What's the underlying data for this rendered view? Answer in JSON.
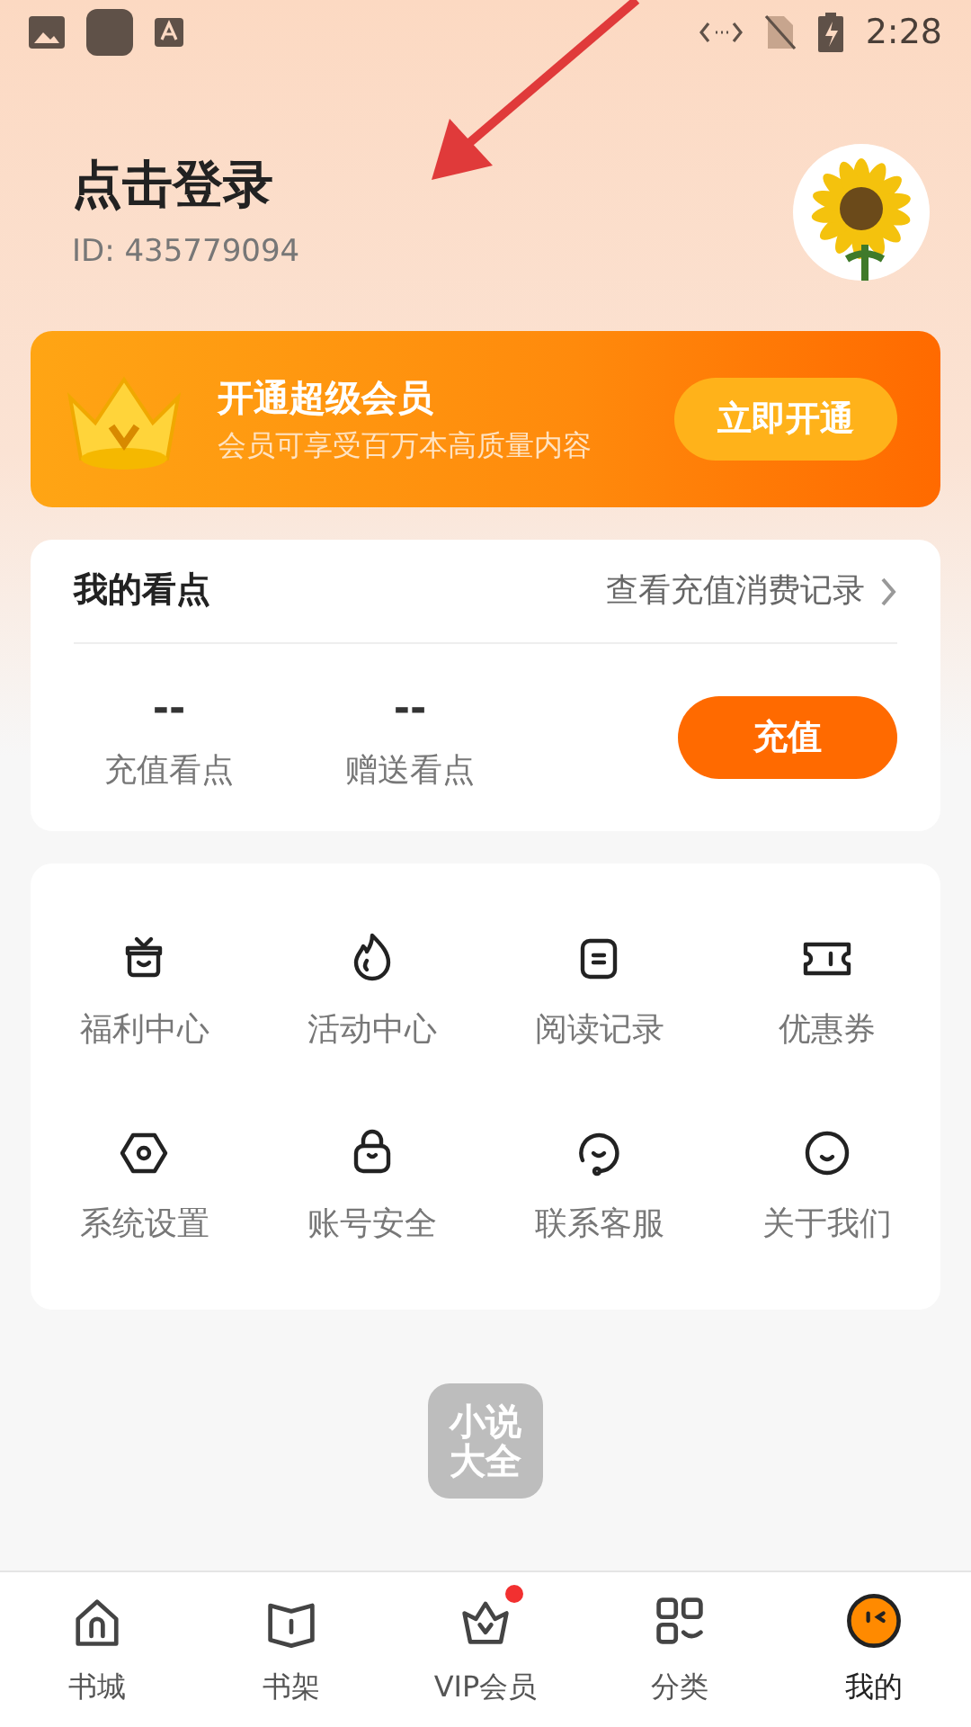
{
  "status_bar": {
    "time": "2:28"
  },
  "profile": {
    "name": "点击登录",
    "id": "ID: 435779094"
  },
  "vip_banner": {
    "title": "开通超级会员",
    "subtitle": "会员可享受百万本高质量内容",
    "button": "立即开通"
  },
  "points": {
    "title": "我的看点",
    "link": "查看充值消费记录",
    "stats": [
      {
        "value": "--",
        "label": "充值看点"
      },
      {
        "value": "--",
        "label": "赠送看点"
      }
    ],
    "button": "充值"
  },
  "menu": [
    {
      "label": "福利中心"
    },
    {
      "label": "活动中心"
    },
    {
      "label": "阅读记录"
    },
    {
      "label": "优惠券"
    },
    {
      "label": "系统设置"
    },
    {
      "label": "账号安全"
    },
    {
      "label": "联系客服"
    },
    {
      "label": "关于我们"
    }
  ],
  "logo": {
    "line1": "小说",
    "line2": "大全"
  },
  "nav": [
    {
      "label": "书城",
      "selected": false,
      "badge": false
    },
    {
      "label": "书架",
      "selected": false,
      "badge": false
    },
    {
      "label": "VIP会员",
      "selected": false,
      "badge": true
    },
    {
      "label": "分类",
      "selected": false,
      "badge": false
    },
    {
      "label": "我的",
      "selected": true,
      "badge": false
    }
  ]
}
